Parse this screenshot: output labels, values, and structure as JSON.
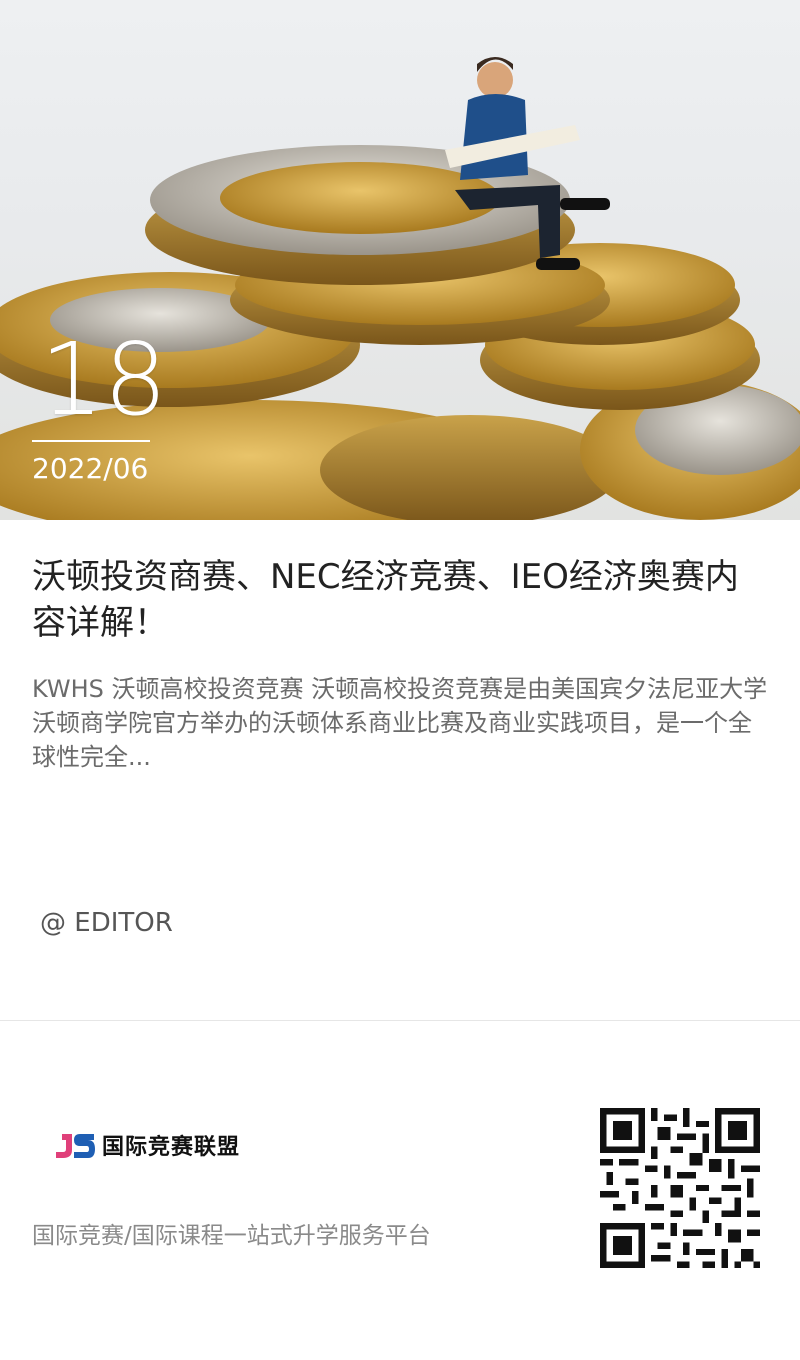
{
  "post": {
    "date_day": "18",
    "date_year_month": "2022/06",
    "title": "沃顿投资商赛、NEC经济竞赛、IEO经济奥赛内容详解！",
    "summary": "KWHS 沃顿高校投资竞赛 沃顿高校投资竞赛是由美国宾夕法尼亚大学沃顿商学院官方举办的沃顿体系商业比赛及商业实践项目，是一个全球性完全...",
    "author": "@ EDITOR"
  },
  "footer": {
    "brand_mark": "JS",
    "brand_name": "国际竞赛联盟",
    "tagline": "国际竞赛/国际课程一站式升学服务平台"
  },
  "colors": {
    "brand_blue": "#1f5fb4",
    "brand_pink": "#e0407a"
  }
}
